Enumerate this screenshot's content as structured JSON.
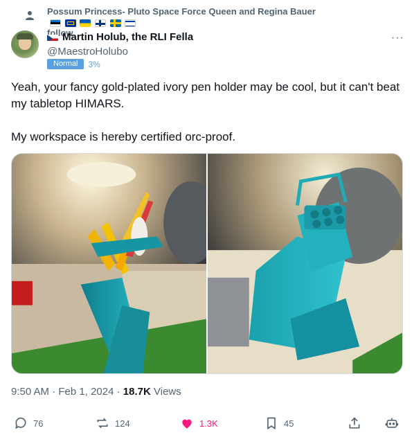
{
  "social_context": {
    "text": "Possum Princess- Pluto Space Force Queen and Regina Bauer",
    "follow": "follow",
    "flag_colors": [
      "#0072ce",
      "#000000",
      "#ffffff",
      "#003399",
      "#ffd500",
      "#005bbb",
      "#ffffff",
      "#003580",
      "#006aa7",
      "#fecc00",
      "#ffffff",
      "#0038b8"
    ]
  },
  "author": {
    "display_name": "Martin Holub, the RLI Fella",
    "handle": "@MaestroHolubo",
    "label": "Normal",
    "percent": "3%"
  },
  "tweet": {
    "line1": "Yeah, your fancy gold-plated ivory pen holder may be cool, but it can't beat my tabletop HIMARS.",
    "line2": "My workspace is hereby certified orc-proof."
  },
  "meta": {
    "time": "9:50 AM",
    "sep1": " · ",
    "date": "Feb 1, 2024",
    "sep2": " · ",
    "views_count": "18.7K",
    "views_label": "Views"
  },
  "actions": {
    "replies": "76",
    "reposts": "124",
    "likes": "1.3K",
    "bookmarks": "45"
  },
  "colors": {
    "like": "#f91880",
    "muted": "#536471",
    "badge": "#5aa0e0",
    "teal": "#1fa6b3"
  }
}
